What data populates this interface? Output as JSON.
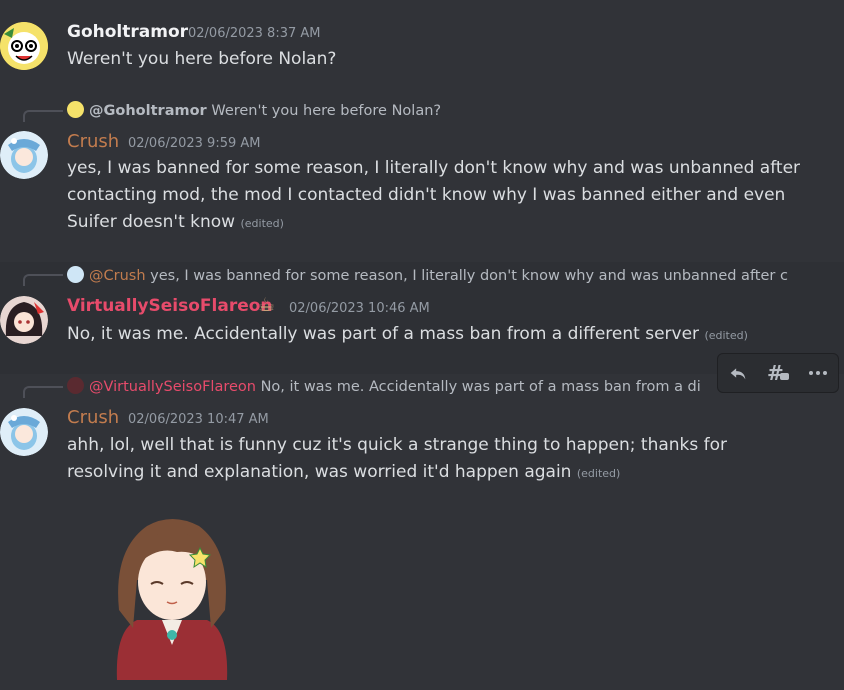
{
  "messages": [
    {
      "author": "Goholtramor",
      "author_color": "#f2f3f5",
      "timestamp": "02/06/2023 8:37 AM",
      "lines": [
        "Weren't you here before Nolan?"
      ]
    },
    {
      "reply": {
        "author": "@Goholtramor",
        "preview": "Weren't you here before Nolan?"
      },
      "author": "Crush",
      "author_color": "#c27c4e",
      "timestamp": "02/06/2023 9:59 AM",
      "lines": [
        "yes, I was banned for some reason, I literally don't know why and was unbanned after",
        "contacting mod, the mod I contacted didn't know why I was banned either and even",
        "Suifer doesn't know"
      ],
      "edited": "(edited)"
    },
    {
      "reply": {
        "author": "@Crush",
        "preview": "yes, I was banned for some reason, I literally don't know why and was unbanned after c"
      },
      "author": "VirtuallySeisoFlareon",
      "author_color": "#e74b6b",
      "author_emoji": "☕",
      "timestamp": "02/06/2023 10:46 AM",
      "lines": [
        "No, it was me. Accidentally was part of a mass ban from a different server"
      ],
      "edited": "(edited)"
    },
    {
      "reply": {
        "author": "@VirtuallySeisoFlareon",
        "preview": "No, it was me. Accidentally was part of a mass ban from a di"
      },
      "author": "Crush",
      "author_color": "#c27c4e",
      "timestamp": "02/06/2023 10:47 AM",
      "lines": [
        "ahh, lol, well that is funny cuz it's quick a strange thing to happen; thanks for",
        "resolving it and explanation, was worried it'd happen again"
      ],
      "edited": "(edited)"
    }
  ],
  "toolbar": {
    "icons": [
      "reply-icon",
      "create-thread-icon",
      "more-icon"
    ]
  },
  "colors": {
    "background": "#313338",
    "hover": "#2e3035",
    "muted": "#949ba4",
    "text": "#dbdee1"
  }
}
